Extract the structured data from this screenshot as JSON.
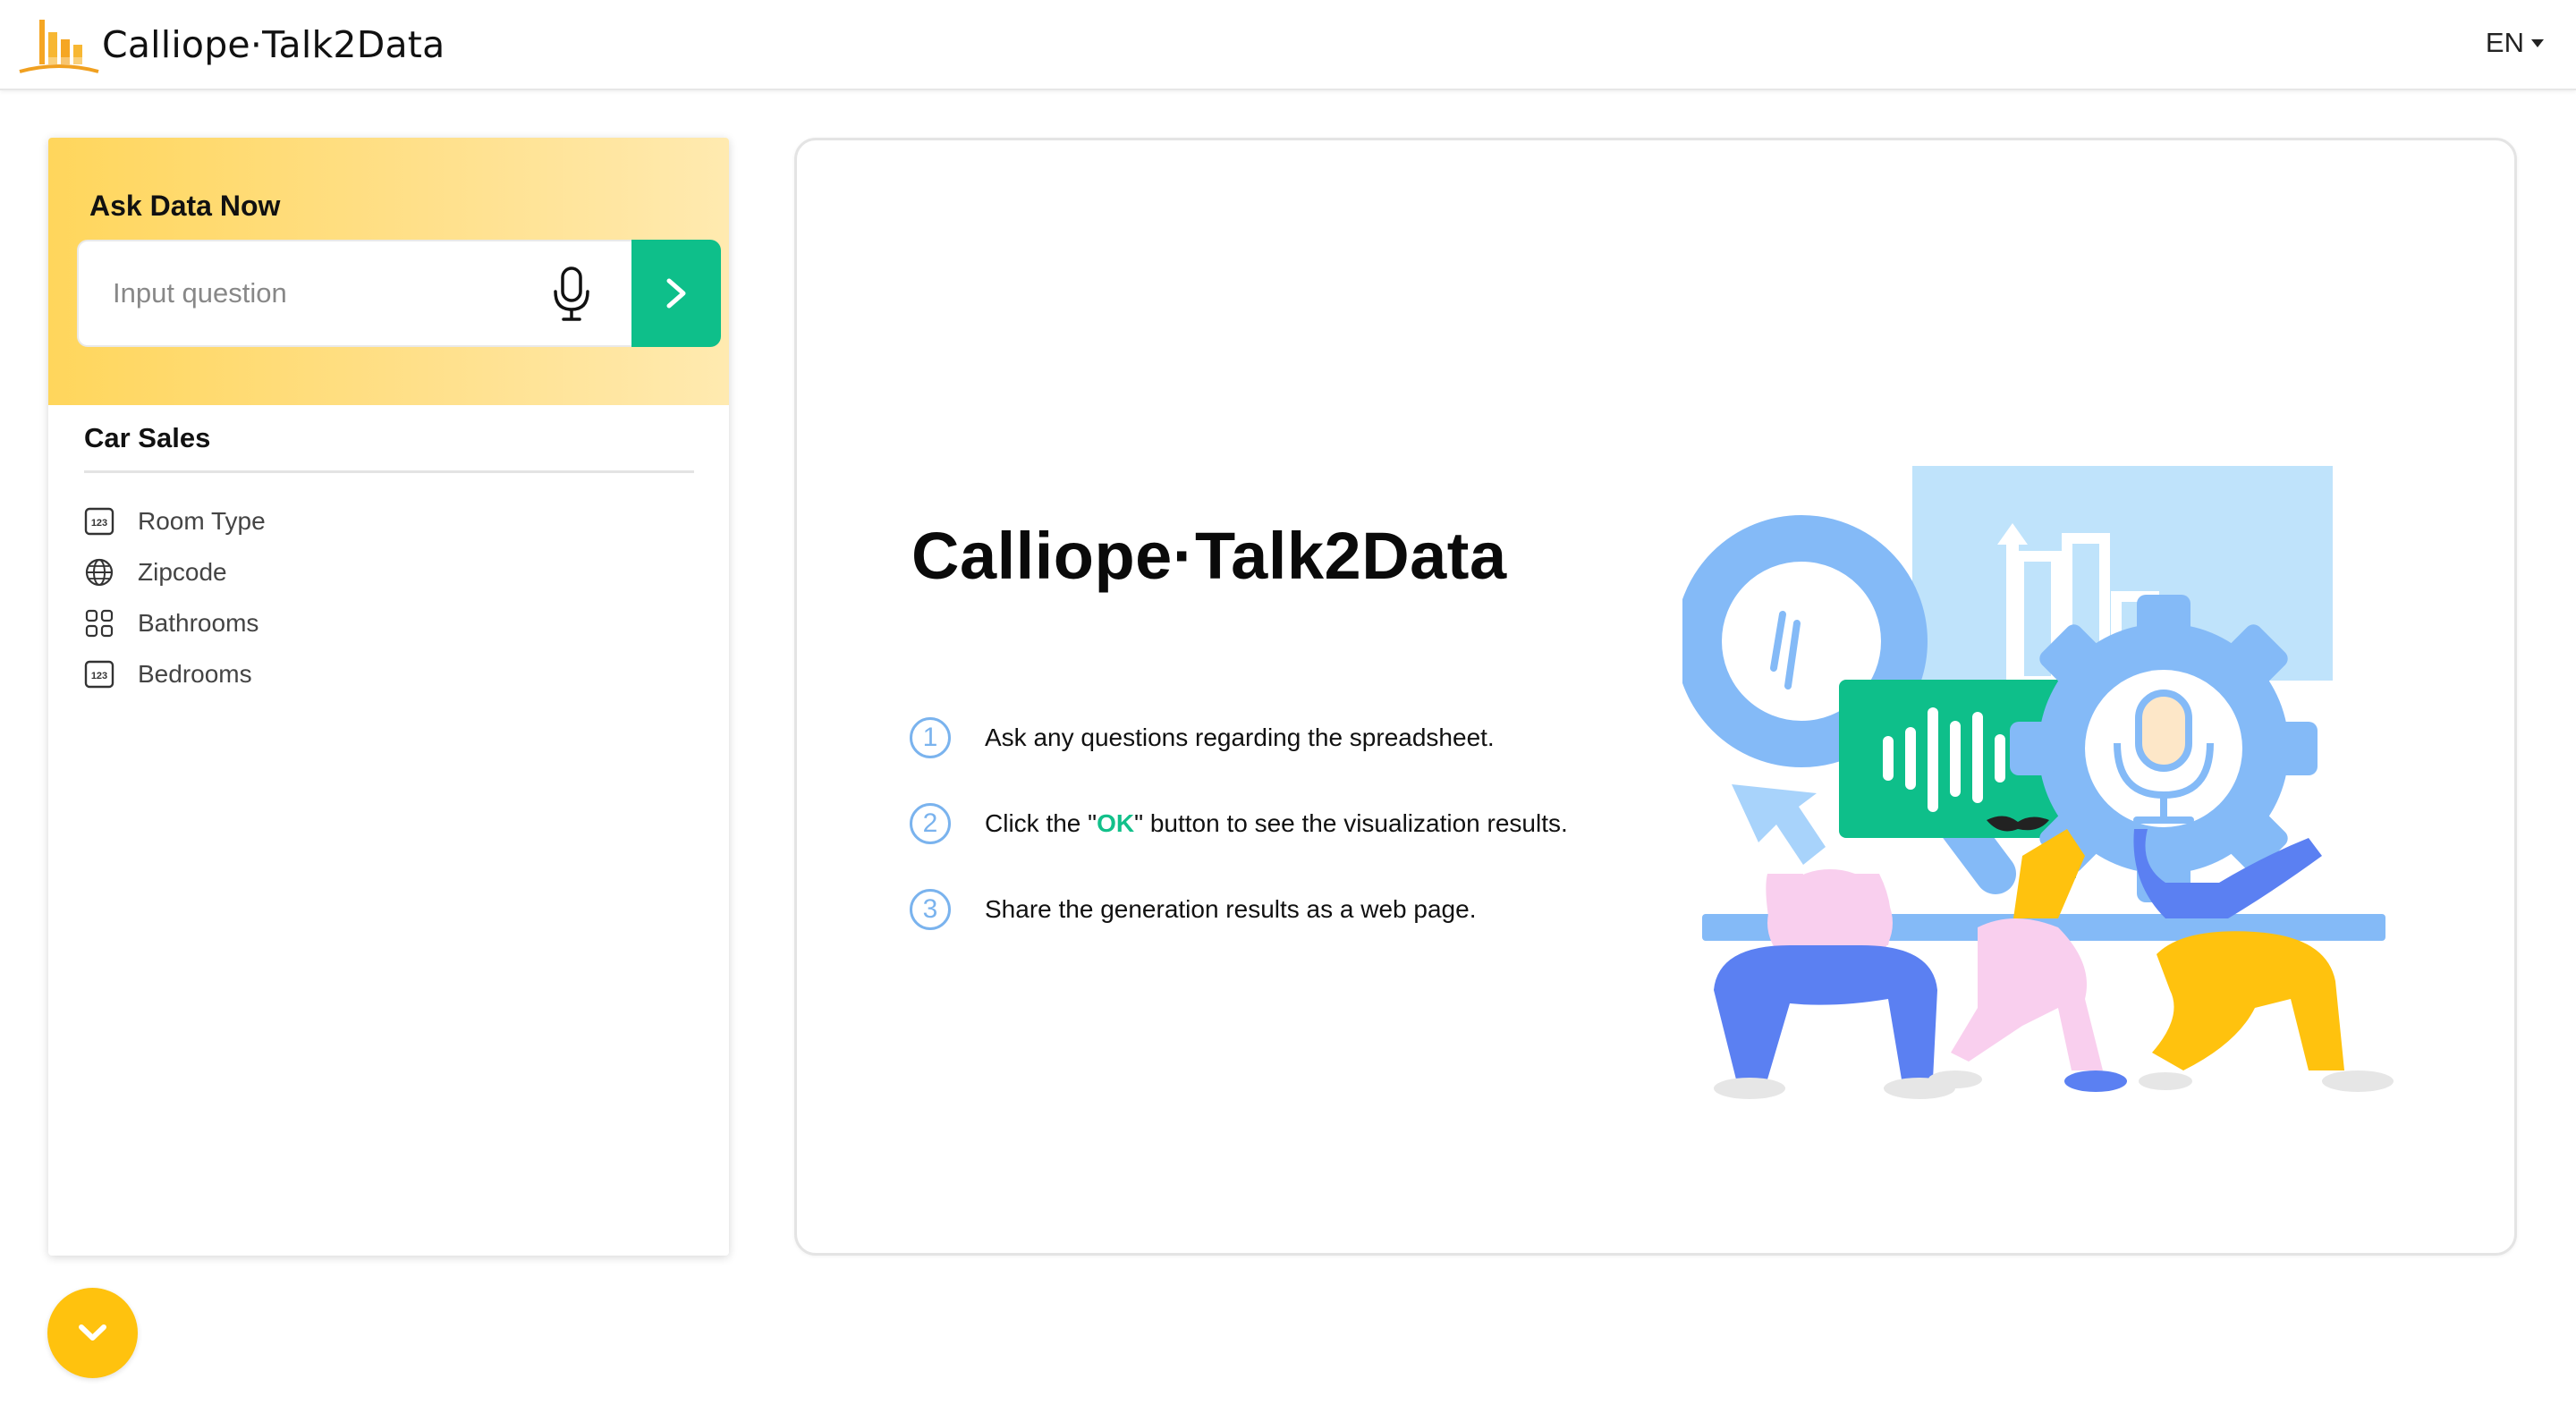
{
  "header": {
    "app_title": "Calliope·Talk2Data",
    "language": "EN",
    "logo_icon": "bar-chart-logo-icon"
  },
  "ask": {
    "title": "Ask Data Now",
    "input_placeholder": "Input question",
    "input_value": "",
    "mic_icon": "microphone-icon",
    "send_icon": "chevron-right-icon"
  },
  "dataset": {
    "title": "Car Sales",
    "fields": [
      {
        "label": "Room Type",
        "icon": "numeric-123-icon"
      },
      {
        "label": "Zipcode",
        "icon": "globe-icon"
      },
      {
        "label": "Bathrooms",
        "icon": "grid-squares-icon"
      },
      {
        "label": "Bedrooms",
        "icon": "numeric-123-icon"
      }
    ]
  },
  "main": {
    "title": "Calliope·Talk2Data",
    "steps": [
      {
        "num": "1",
        "text": "Ask any questions regarding the spreadsheet."
      },
      {
        "num": "2",
        "text_before": "Click the \"",
        "highlight": "OK",
        "text_after": "\" button to see the visualization results."
      },
      {
        "num": "3",
        "text": "Share the generation results as a web page."
      }
    ]
  },
  "collapse_icon": "chevron-down-icon",
  "colors": {
    "accent_yellow": "#ffc20e",
    "accent_green": "#0ebf8a",
    "step_blue": "#7ab3ee"
  }
}
